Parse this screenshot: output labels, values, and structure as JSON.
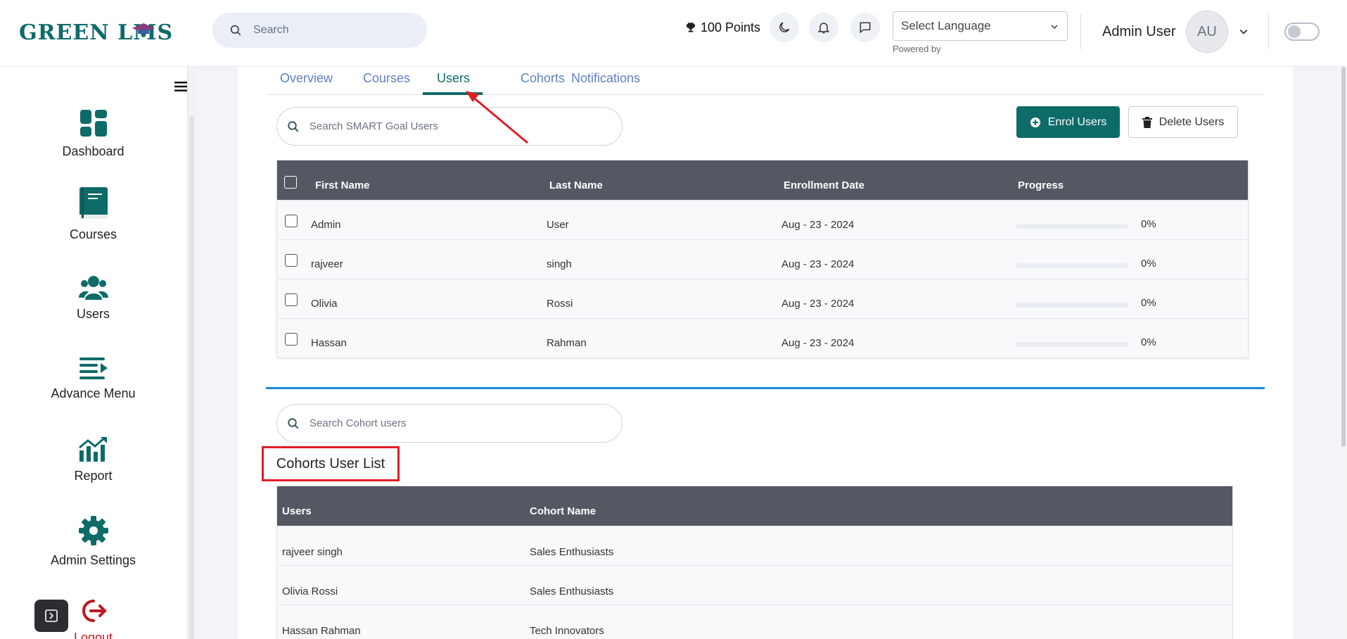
{
  "header": {
    "logo_text_left": "GREEN L",
    "logo_text_right": "MS",
    "search_placeholder": "Search",
    "points": "100 Points",
    "language_select": "Select Language",
    "powered_by": "Powered by",
    "admin_name": "Admin User",
    "avatar_initials": "AU"
  },
  "sidebar": {
    "items": [
      {
        "label": "Dashboard",
        "icon": "dashboard-icon"
      },
      {
        "label": "Courses",
        "icon": "book-icon"
      },
      {
        "label": "Users",
        "icon": "users-icon"
      },
      {
        "label": "Advance Menu",
        "icon": "menu-icon"
      },
      {
        "label": "Report",
        "icon": "chart-icon"
      },
      {
        "label": "Admin Settings",
        "icon": "gear-icon"
      },
      {
        "label": "Logout",
        "icon": "logout-icon"
      }
    ]
  },
  "tabs": [
    "Overview",
    "Courses",
    "Users",
    "Cohorts",
    "Notifications"
  ],
  "active_tab": "Users",
  "goal_search_placeholder": "Search SMART Goal Users",
  "buttons": {
    "enrol": "Enrol Users",
    "delete": "Delete Users"
  },
  "users_table": {
    "columns": [
      "First Name",
      "Last Name",
      "Enrollment Date",
      "Progress"
    ],
    "rows": [
      {
        "first": "Admin",
        "last": "User",
        "date": "Aug - 23 - 2024",
        "progress": "0%",
        "progress_value": 0
      },
      {
        "first": "rajveer",
        "last": "singh",
        "date": "Aug - 23 - 2024",
        "progress": "0%",
        "progress_value": 0
      },
      {
        "first": "Olivia",
        "last": "Rossi",
        "date": "Aug - 23 - 2024",
        "progress": "0%",
        "progress_value": 0
      },
      {
        "first": "Hassan",
        "last": "Rahman",
        "date": "Aug - 23 - 2024",
        "progress": "0%",
        "progress_value": 0
      }
    ]
  },
  "cohort_search_placeholder": "Search Cohort users",
  "cohort_title": "Cohorts User List",
  "cohort_table": {
    "columns": [
      "Users",
      "Cohort Name"
    ],
    "rows": [
      {
        "user": "rajveer singh",
        "cohort": "Sales Enthusiasts"
      },
      {
        "user": "Olivia Rossi",
        "cohort": "Sales Enthusiasts"
      },
      {
        "user": "Hassan Rahman",
        "cohort": "Tech Innovators"
      }
    ]
  },
  "colors": {
    "brand": "#0d6b68",
    "tab_link": "#5f7fc5",
    "table_header": "#545862",
    "annotation_red": "#e11d25"
  }
}
